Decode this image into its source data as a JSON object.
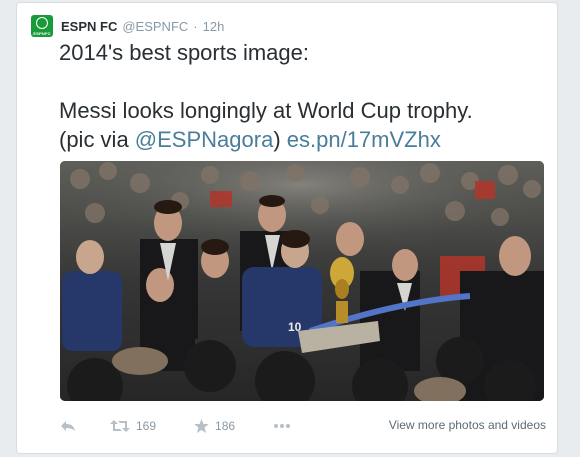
{
  "tweet": {
    "author_name": "ESPN FC",
    "author_handle": "@ESPNFC",
    "separator": "·",
    "time": "12h",
    "avatar_text": "ESPNFC",
    "text_line1": "2014's best sports image:",
    "text_line2": "Messi looks longingly at World Cup trophy.",
    "text_line3_prefix": "(pic via ",
    "mention": "@ESPNagora",
    "text_line3_mid": ") ",
    "url": "es.pn/17mVZhx"
  },
  "media": {
    "photo_icon": "photo-image"
  },
  "actions": {
    "reply_icon": "reply-icon",
    "retweet_count": "169",
    "favorite_count": "186",
    "view_more_label": "View more photos and videos"
  },
  "colors": {
    "link": "#4a7d9a",
    "avatar_bg": "#1a9b3a",
    "action_gray": "#8899a6"
  }
}
